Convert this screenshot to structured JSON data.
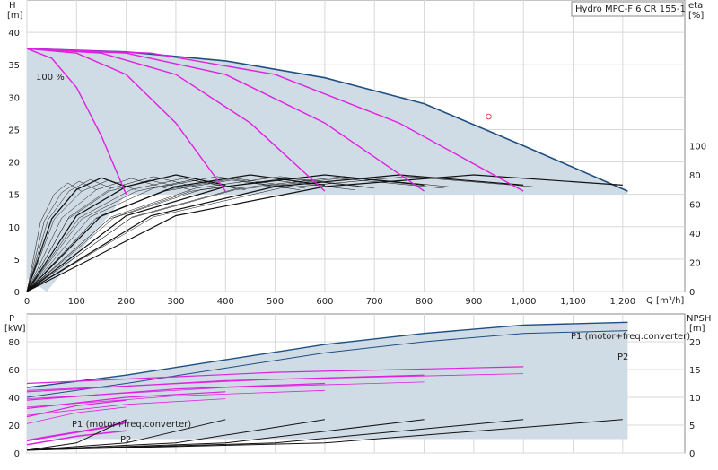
{
  "title": "Hydro MPC-F 6 CR 155-1",
  "colors": {
    "envelope_fill": "#cfdbe5",
    "envelope_line": "#1f4f82",
    "speed_curve": "#e020e0",
    "pump_curve": "#111111",
    "grid": "#d8d8d8",
    "duty_point": "#e05050"
  },
  "chart_data": [
    {
      "type": "line",
      "name": "head-efficiency",
      "xlabel": "Q [m³/h]",
      "ylabel_left": "H",
      "ylabel_left_unit": "[m]",
      "ylabel_right": "eta",
      "ylabel_right_unit": "[%]",
      "xlim": [
        0,
        1325
      ],
      "ylim_left": [
        0,
        45
      ],
      "ylim_right_ticks": [
        0,
        20,
        40,
        60,
        80,
        100
      ],
      "x_ticks": [
        "0",
        "100",
        "200",
        "300",
        "400",
        "500",
        "600",
        "700",
        "800",
        "900",
        "1,000",
        "1,100",
        "1,200"
      ],
      "y_ticks_left": [
        "0",
        "5",
        "10",
        "15",
        "20",
        "25",
        "30",
        "35",
        "40"
      ],
      "y_ticks_right": [
        "0",
        "20",
        "40",
        "60",
        "80",
        "100"
      ],
      "grid": true,
      "annotation": "100 %",
      "duty_point": {
        "q": 930,
        "h": 27
      },
      "envelope_max_head": {
        "x": [
          0,
          200,
          400,
          600,
          800,
          1000,
          1210
        ],
        "y": [
          37.5,
          37,
          35.6,
          33,
          29,
          22.5,
          15.5
        ]
      },
      "max_speed_curves": [
        {
          "n_pumps": 1,
          "x": [
            0,
            50,
            100,
            150,
            200
          ],
          "y": [
            37.5,
            36,
            31.5,
            24,
            15
          ]
        },
        {
          "n_pumps": 2,
          "x": [
            0,
            100,
            200,
            300,
            400
          ],
          "y": [
            37.5,
            36.8,
            33.5,
            26,
            15.5
          ]
        },
        {
          "n_pumps": 3,
          "x": [
            0,
            150,
            300,
            450,
            600
          ],
          "y": [
            37.5,
            36.8,
            33.5,
            26,
            15.5
          ]
        },
        {
          "n_pumps": 4,
          "x": [
            0,
            200,
            400,
            600,
            800
          ],
          "y": [
            37.5,
            36.8,
            33.5,
            26,
            15.5
          ]
        },
        {
          "n_pumps": 5,
          "x": [
            0,
            250,
            500,
            750,
            1000
          ],
          "y": [
            37.5,
            36.8,
            33.5,
            26,
            15.5
          ]
        }
      ],
      "efficiency_curves_pct": [
        {
          "n_pumps": 1,
          "x": [
            0,
            50,
            100,
            150,
            200
          ],
          "y": [
            0,
            50,
            70,
            78,
            72
          ]
        },
        {
          "n_pumps": 2,
          "x": [
            0,
            100,
            200,
            300,
            400
          ],
          "y": [
            0,
            52,
            72,
            80,
            73
          ]
        },
        {
          "n_pumps": 3,
          "x": [
            0,
            150,
            300,
            450,
            600
          ],
          "y": [
            0,
            52,
            72,
            80,
            73
          ]
        },
        {
          "n_pumps": 4,
          "x": [
            0,
            200,
            400,
            600,
            800
          ],
          "y": [
            0,
            52,
            72,
            80,
            73
          ]
        },
        {
          "n_pumps": 5,
          "x": [
            0,
            250,
            500,
            750,
            1000
          ],
          "y": [
            0,
            52,
            72,
            80,
            73
          ]
        },
        {
          "n_pumps": 6,
          "x": [
            0,
            300,
            600,
            900,
            1200
          ],
          "y": [
            0,
            52,
            72,
            80,
            73
          ]
        }
      ]
    },
    {
      "type": "line",
      "name": "power-npsh",
      "ylabel_left": "P",
      "ylabel_left_unit": "[kW]",
      "ylabel_right": "NPSH",
      "ylabel_right_unit": "[m]",
      "xlim": [
        0,
        1325
      ],
      "ylim_left": [
        0,
        100
      ],
      "ylim_right": [
        0,
        25
      ],
      "y_ticks_left": [
        "0",
        "20",
        "40",
        "60",
        "80"
      ],
      "y_ticks_right": [
        "0",
        "5",
        "10",
        "15",
        "20"
      ],
      "grid": true,
      "labels": {
        "p1_right": "P1 (motor+freq.converter)",
        "p2_right": "P2",
        "p1_left": "P1 (motor+freq.converter)",
        "p2_left": "P2"
      },
      "p1_envelope": {
        "x": [
          0,
          200,
          400,
          600,
          800,
          1000,
          1210
        ],
        "y": [
          47,
          56,
          67,
          78,
          86,
          92,
          94
        ]
      },
      "p2_envelope": {
        "x": [
          0,
          200,
          400,
          600,
          800,
          1000,
          1210
        ],
        "y": [
          40,
          50,
          61,
          72,
          80,
          86,
          88
        ]
      },
      "p1_max_speed": {
        "x": [
          0,
          50,
          100,
          150,
          200
        ],
        "y": [
          9,
          12,
          15,
          18,
          22
        ]
      },
      "p2_max_speed": {
        "x": [
          0,
          50,
          100,
          150,
          200
        ],
        "y": [
          6,
          9,
          12,
          14,
          16
        ]
      },
      "npsh_curves_m": [
        {
          "n_pumps": 1,
          "x": [
            0,
            100,
            200
          ],
          "y": [
            0.5,
            1.8,
            6
          ]
        },
        {
          "n_pumps": 2,
          "x": [
            0,
            200,
            400
          ],
          "y": [
            0.5,
            1.8,
            6
          ]
        },
        {
          "n_pumps": 3,
          "x": [
            0,
            300,
            600
          ],
          "y": [
            0.5,
            1.8,
            6
          ]
        },
        {
          "n_pumps": 4,
          "x": [
            0,
            400,
            800
          ],
          "y": [
            0.5,
            1.8,
            6
          ]
        },
        {
          "n_pumps": 5,
          "x": [
            0,
            500,
            1000
          ],
          "y": [
            0.5,
            1.8,
            6
          ]
        },
        {
          "n_pumps": 6,
          "x": [
            0,
            600,
            1200
          ],
          "y": [
            0.5,
            1.8,
            6
          ]
        }
      ]
    }
  ]
}
